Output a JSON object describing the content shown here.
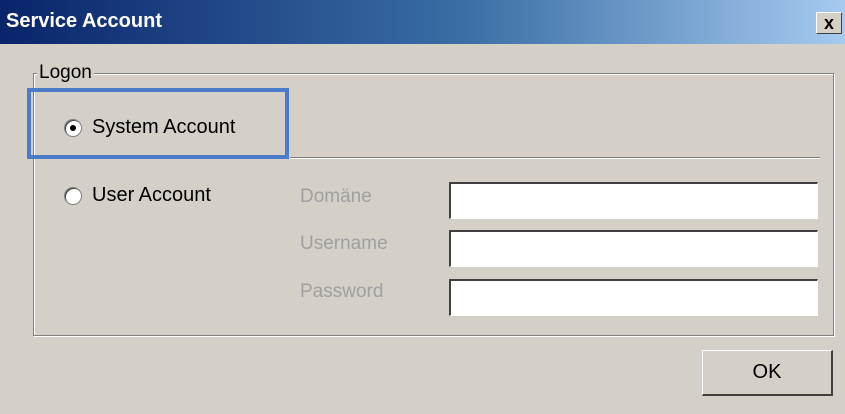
{
  "window": {
    "title": "Service Account",
    "close_glyph": "x"
  },
  "logon": {
    "group_label": "Logon",
    "system_account": {
      "label": "System Account",
      "selected": true
    },
    "user_account": {
      "label": "User Account",
      "selected": false
    },
    "fields": {
      "domain": {
        "label": "Domäne",
        "value": ""
      },
      "username": {
        "label": "Username",
        "value": ""
      },
      "password": {
        "label": "Password",
        "value": ""
      }
    }
  },
  "buttons": {
    "ok_label": "OK"
  },
  "colors": {
    "title_gradient_start": "#0a246a",
    "title_gradient_end": "#a6caf0",
    "highlight_border": "#4a7cc9",
    "dialog_bg": "#d4d0c8",
    "disabled_label": "#a0a0a0"
  },
  "icons": {
    "close": "close-icon",
    "radio_on": "radio-checked-icon",
    "radio_off": "radio-unchecked-icon"
  }
}
